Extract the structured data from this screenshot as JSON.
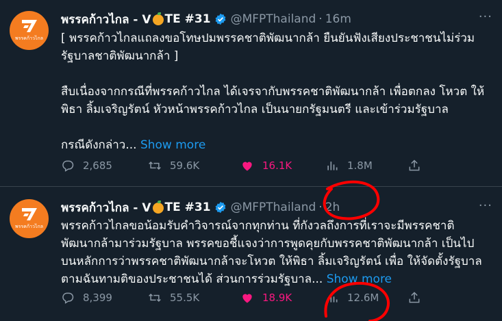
{
  "tweets": [
    {
      "name": "พรรคก้าวไกล - V",
      "name_suffix": "TE #31",
      "handle": "@MFPThailand",
      "time": "16m",
      "avatar_text": "พรรคก้าวไกล",
      "lines": [
        "[ พรรคก้าวไกลแถลงขอโทษปมพรรคชาติพัฒนากล้า ยืนยันฟังเสียงประชาชนไม่ร่วม",
        "รัฐบาลชาติพัฒนากล้า ]",
        "",
        "สืบเนื่องจากกรณีที่พรรคก้าวไกล ได้เจรจากับพรรคชาติพัฒนากล้า เพื่อตกลง โหวต ให้",
        "พิธา ลิ้มเจริญรัตน์ หัวหน้าพรรคก้าวไกล เป็นนายกรัฐมนตรี และเข้าร่วมรัฐบาล",
        "",
        "กรณีดังกล่าว..."
      ],
      "show_more": "Show more",
      "replies": "2,685",
      "retweets": "59.6K",
      "likes": "16.1K",
      "views": "1.8M"
    },
    {
      "name": "พรรคก้าวไกล - V",
      "name_suffix": "TE #31",
      "handle": "@MFPThailand",
      "time": "2h",
      "avatar_text": "พรรคก้าวไกล",
      "lines": [
        "พรรคก้าวไกลขอน้อมรับคำวิจารณ์จากทุกท่าน ที่กังวลถึงการที่เราจะมีพรรคชาติ",
        "พัฒนากล้ามาร่วมรัฐบาล พรรคขอชี้แจงว่าการพูดคุยกับพรรคชาติพัฒนากล้า เป็นไป",
        "บนหลักการว่าพรรคชาติพัฒนากล้าจะโหวต ให้พิธา ลิ้มเจริญรัตน์ เพื่อ ให้จัดตั้งรัฐบาล",
        "ตามฉันทามติของประชาชนได้ ส่วนการร่วมรัฐบาล..."
      ],
      "show_more": "Show more",
      "replies": "8,399",
      "retweets": "55.5K",
      "likes": "18.9K",
      "views": "12.6M"
    }
  ],
  "colors": {
    "background": "#15202b",
    "accent": "#1d9bf0",
    "like": "#f91880",
    "muted": "#8b98a5",
    "avatar": "#f47c20",
    "annotation": "#ff0000"
  },
  "icons": [
    "verified-badge-icon",
    "more-icon",
    "reply-icon",
    "retweet-icon",
    "heart-icon",
    "views-icon",
    "share-icon",
    "orange-emoji-icon"
  ]
}
